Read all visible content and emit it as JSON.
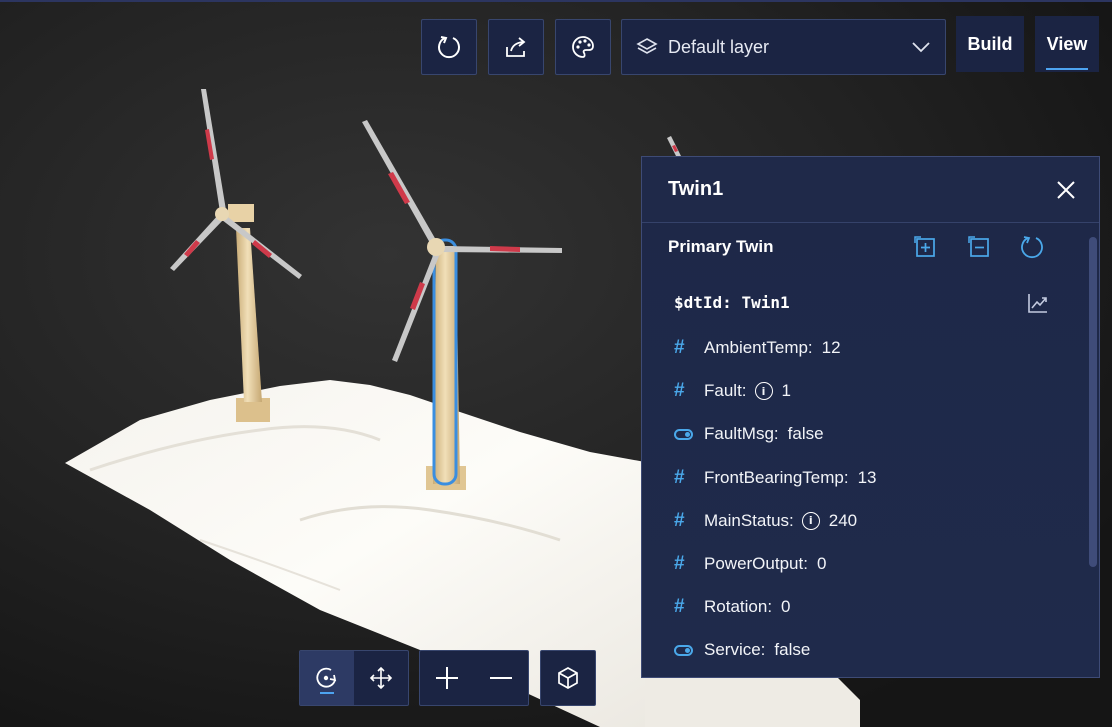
{
  "toolbar": {
    "reset_icon": "rotate-icon",
    "share_icon": "share-icon",
    "theme_icon": "palette-icon",
    "layer_select": {
      "icon": "layers-icon",
      "value": "Default layer"
    },
    "build_label": "Build",
    "view_label": "View",
    "active_mode": "View"
  },
  "panel": {
    "title": "Twin1",
    "section_title": "Primary Twin",
    "dtid_label": "$dtId:",
    "dtid_value": "Twin1",
    "properties": [
      {
        "type": "number",
        "name": "AmbientTemp:",
        "info": false,
        "value": "12"
      },
      {
        "type": "number",
        "name": "Fault:",
        "info": true,
        "value": "1"
      },
      {
        "type": "boolean",
        "name": "FaultMsg:",
        "info": false,
        "value": "false"
      },
      {
        "type": "number",
        "name": "FrontBearingTemp:",
        "info": false,
        "value": "13"
      },
      {
        "type": "number",
        "name": "MainStatus:",
        "info": true,
        "value": "240"
      },
      {
        "type": "number",
        "name": "PowerOutput:",
        "info": false,
        "value": "0"
      },
      {
        "type": "number",
        "name": "Rotation:",
        "info": false,
        "value": "0"
      },
      {
        "type": "boolean",
        "name": "Service:",
        "info": false,
        "value": "false"
      }
    ]
  },
  "controls": {
    "camera_mode": "orbit",
    "items": [
      "orbit-icon",
      "pan-icon",
      "zoom-in-icon",
      "zoom-out-icon",
      "cube-icon"
    ]
  },
  "colors": {
    "panel_bg": "#1f2a4b",
    "accent": "#4aa8ea",
    "toolbar_bg": "#1b2443",
    "blade_red": "#cf3a4a",
    "tower": "#e6cf9f",
    "selection": "#3a8ee0"
  }
}
